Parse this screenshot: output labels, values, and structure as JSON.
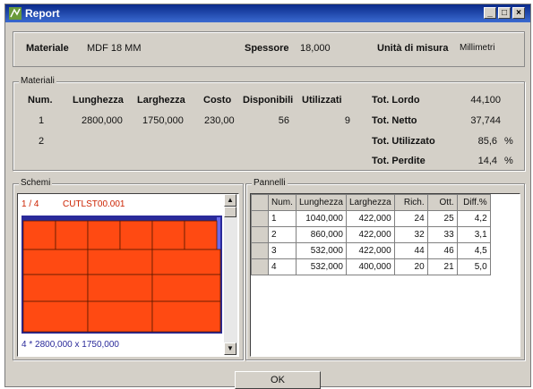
{
  "window": {
    "title": "Report"
  },
  "header": {
    "materiale_label": "Materiale",
    "materiale_value": "MDF 18 MM",
    "spessore_label": "Spessore",
    "spessore_value": "18,000",
    "unita_label": "Unità di misura",
    "unita_value": "Millimetri"
  },
  "materiali": {
    "group_label": "Materiali",
    "columns": [
      "Num.",
      "Lunghezza",
      "Larghezza",
      "Costo",
      "Disponibili",
      "Utilizzati"
    ],
    "rows": [
      [
        "1",
        "2800,000",
        "1750,000",
        "230,00",
        "56",
        "9"
      ],
      [
        "2",
        "",
        "",
        "",
        "",
        ""
      ]
    ],
    "totals": [
      {
        "label": "Tot. Lordo",
        "value": "44,100",
        "unit": ""
      },
      {
        "label": "Tot. Netto",
        "value": "37,744",
        "unit": ""
      },
      {
        "label": "Tot. Utilizzato",
        "value": "85,6",
        "unit": "%"
      },
      {
        "label": "Tot. Perdite",
        "value": "14,4",
        "unit": "%"
      }
    ]
  },
  "schemi": {
    "group_label": "Schemi",
    "page": "1 / 4",
    "name": "CUTLST00.001",
    "footer": "4 * 2800,000 x 1750,000"
  },
  "pannelli": {
    "group_label": "Pannelli",
    "columns": [
      "Num.",
      "Lunghezza",
      "Larghezza",
      "Rich.",
      "Ott.",
      "Diff.%"
    ],
    "rows": [
      [
        "1",
        "1040,000",
        "422,000",
        "24",
        "25",
        "4,2"
      ],
      [
        "2",
        "860,000",
        "422,000",
        "32",
        "33",
        "3,1"
      ],
      [
        "3",
        "532,000",
        "422,000",
        "44",
        "46",
        "4,5"
      ],
      [
        "4",
        "532,000",
        "400,000",
        "20",
        "21",
        "5,0"
      ]
    ]
  },
  "ok_label": "OK",
  "colors": {
    "panel_fill": "#ff4a12",
    "sheet_border": "#2a2a9a",
    "title_red": "#cc2200"
  }
}
